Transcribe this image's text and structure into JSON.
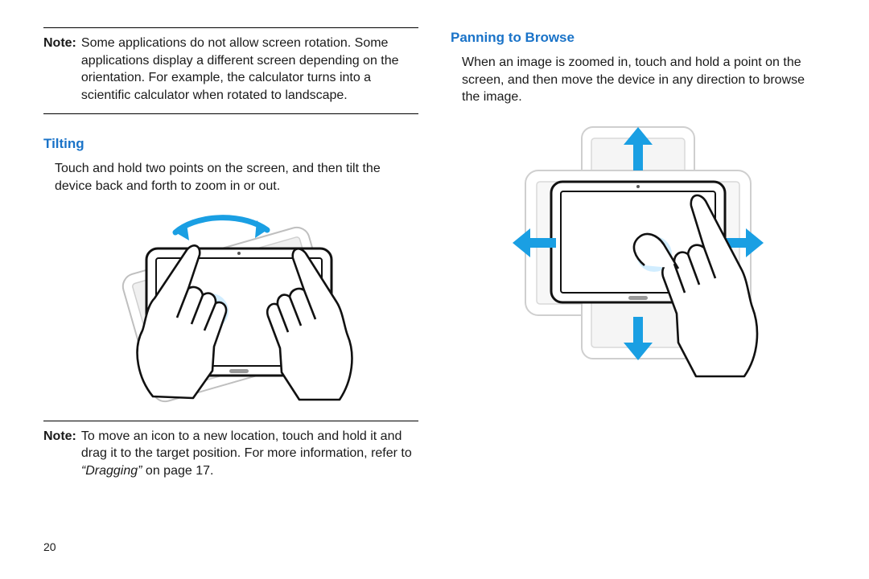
{
  "left": {
    "note1": {
      "label": "Note:",
      "body": "Some applications do not allow screen rotation. Some applications display a different screen depending on the orientation. For example, the calculator turns into a scientific calculator when rotated to landscape."
    },
    "tilting": {
      "heading": "Tilting",
      "body": "Touch and hold two points on the screen, and then tilt the device back and forth to zoom in or out."
    },
    "note2": {
      "label": "Note:",
      "body_pre": "To move an icon to a new location, touch and hold it and drag it to the target position. For more information, refer to ",
      "body_ital": "“Dragging”",
      "body_post": " on page 17."
    },
    "pagenum": "20"
  },
  "right": {
    "panning": {
      "heading": "Panning to Browse",
      "body": "When an image is zoomed in, touch and hold a point on the screen, and then move the device in any direction to browse the image."
    }
  },
  "colors": {
    "heading": "#1a73c8",
    "arrow": "#1a9fe3",
    "touch": "#b9e3ff"
  }
}
